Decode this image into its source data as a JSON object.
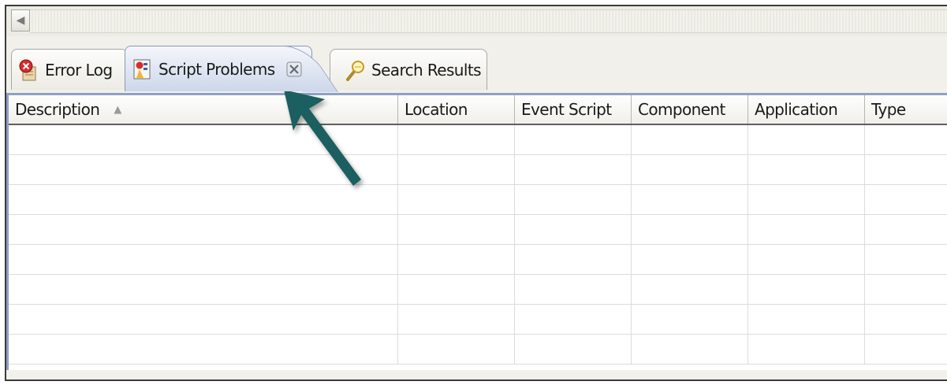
{
  "tabs": [
    {
      "label": "Error Log",
      "icon": "error-log-icon",
      "active": false
    },
    {
      "label": "Script Problems",
      "icon": "script-problems-icon",
      "active": true
    },
    {
      "label": "Search Results",
      "icon": "search-results-icon",
      "active": false
    }
  ],
  "table": {
    "columns": [
      "Description",
      "Location",
      "Event Script",
      "Component",
      "Application",
      "Type"
    ],
    "sort_indicator": "▲",
    "rows": [
      [
        "",
        "",
        "",
        "",
        "",
        ""
      ],
      [
        "",
        "",
        "",
        "",
        "",
        ""
      ],
      [
        "",
        "",
        "",
        "",
        "",
        ""
      ],
      [
        "",
        "",
        "",
        "",
        "",
        ""
      ],
      [
        "",
        "",
        "",
        "",
        "",
        ""
      ],
      [
        "",
        "",
        "",
        "",
        "",
        ""
      ],
      [
        "",
        "",
        "",
        "",
        "",
        ""
      ],
      [
        "",
        "",
        "",
        "",
        "",
        ""
      ]
    ]
  },
  "colors": {
    "active_tab": "#cdd7ea",
    "table_border": "#8fa0c6",
    "annotation_arrow": "#1f5f61"
  }
}
